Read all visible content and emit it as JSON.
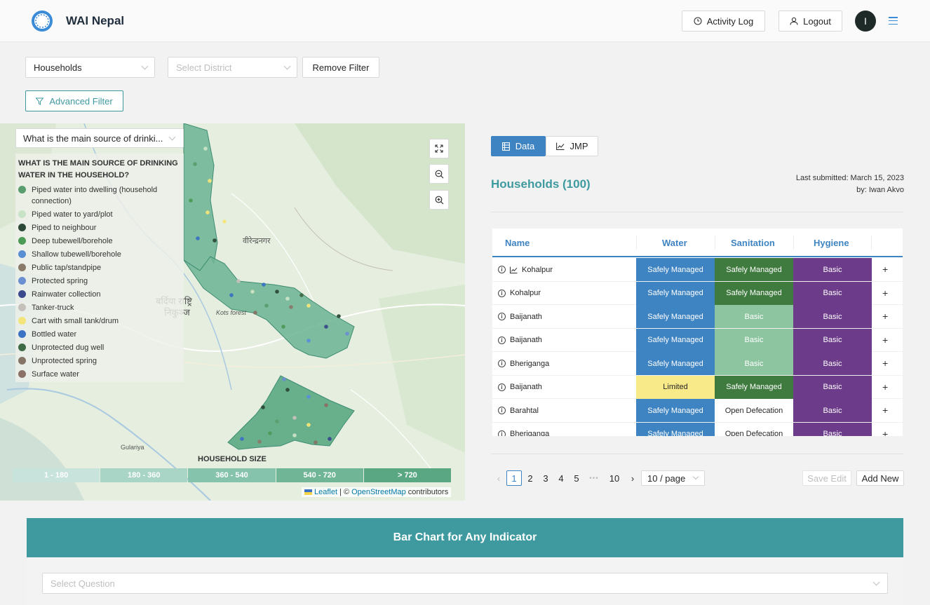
{
  "header": {
    "brand": "WAI Nepal",
    "activity_log": "Activity Log",
    "logout": "Logout",
    "avatar_initial": "I"
  },
  "filters": {
    "form_select": "Households",
    "district_placeholder": "Select District",
    "remove_filter": "Remove Filter",
    "advanced_filter": "Advanced Filter"
  },
  "map": {
    "question_select": "What is the main source of drinki...",
    "legend_title": "WHAT IS THE MAIN SOURCE OF DRINKING WATER IN THE HOUSEHOLD?",
    "legend": [
      {
        "label": "Piped water into dwelling (household connection)",
        "color": "#5a9e6f"
      },
      {
        "label": "Piped water to yard/plot",
        "color": "#c9e3c6"
      },
      {
        "label": "Piped to neighbour",
        "color": "#2d4a38"
      },
      {
        "label": "Deep tubewell/borehole",
        "color": "#4e9a57"
      },
      {
        "label": "Shallow tubewell/borehole",
        "color": "#5b8fd4"
      },
      {
        "label": "Public tap/standpipe",
        "color": "#8a7a6a"
      },
      {
        "label": "Protected spring",
        "color": "#6b8fd0"
      },
      {
        "label": "Rainwater collection",
        "color": "#3a4a8c"
      },
      {
        "label": "Tanker-truck",
        "color": "#c6c0bb"
      },
      {
        "label": "Cart with small tank/drum",
        "color": "#f3e57a"
      },
      {
        "label": "Bottled water",
        "color": "#3b72c4"
      },
      {
        "label": "Unprotected dug well",
        "color": "#3f6a46"
      },
      {
        "label": "Unprotected spring",
        "color": "#857468"
      },
      {
        "label": "Surface water",
        "color": "#8a7066"
      }
    ],
    "place_labels": {
      "birendranagar": "वीरेन्द्रनगर",
      "bardiya1": "बर्दिया राष्ट्रि",
      "bardiya2": "निकुञ्ज",
      "kots": "Kots forest",
      "gularya": "Gulariya"
    },
    "household_size_title": "HOUSEHOLD SIZE",
    "household_bins": [
      "1 - 180",
      "180 - 360",
      "360 - 540",
      "540 - 720",
      "> 720"
    ],
    "household_bin_colors": [
      "#c8e3dc",
      "#a9d5c6",
      "#86c3ad",
      "#6fb596",
      "#5aa883"
    ],
    "attribution_leaflet": "Leaflet",
    "attribution_sep": "| ©",
    "attribution_osm": "OpenStreetMap",
    "attribution_tail": "contributors"
  },
  "panel": {
    "tab_data": "Data",
    "tab_jmp": "JMP",
    "title": "Households (100)",
    "last_submitted": "Last submitted: March 15, 2023",
    "submitted_by": "by: Iwan Akvo",
    "columns": {
      "name": "Name",
      "water": "Water",
      "sanitation": "Sanitation",
      "hygiene": "Hygiene"
    },
    "rows": [
      {
        "name": "Kohalpur",
        "chart_icon": true,
        "water": "Safely Managed",
        "sanitation": "Safely Managed",
        "hygiene": "Basic"
      },
      {
        "name": "Kohalpur",
        "water": "Safely Managed",
        "sanitation": "Safely Managed",
        "hygiene": "Basic"
      },
      {
        "name": "Baijanath",
        "water": "Safely Managed",
        "sanitation": "Basic",
        "hygiene": "Basic"
      },
      {
        "name": "Baijanath",
        "water": "Safely Managed",
        "sanitation": "Basic",
        "hygiene": "Basic"
      },
      {
        "name": "Bheriganga",
        "water": "Safely Managed",
        "sanitation": "Basic",
        "hygiene": "Basic"
      },
      {
        "name": "Baijanath",
        "water": "Limited",
        "sanitation": "Safely Managed",
        "hygiene": "Basic"
      },
      {
        "name": "Barahtal",
        "water": "Safely Managed",
        "sanitation": "Open Defecation",
        "hygiene": "Basic"
      },
      {
        "name": "Bheriganga",
        "water": "Safely Managed",
        "sanitation": "Open Defecation",
        "hygiene": "Basic"
      }
    ],
    "status_colors": {
      "water_safely_managed": "#3f84c2",
      "water_limited": "#f8ea89",
      "san_safely_managed": "#3f7a3f",
      "san_basic": "#8dc5a1",
      "san_open_defecation": "#ffffff",
      "hyg_basic": "#6c3b8a"
    },
    "pagination": {
      "pages": [
        "1",
        "2",
        "3",
        "4",
        "5",
        "•••",
        "10"
      ],
      "page_size": "10 / page"
    },
    "save_edit": "Save Edit",
    "add_new": "Add New"
  },
  "bar_chart": {
    "title": "Bar Chart for Any Indicator",
    "question_placeholder": "Select Question"
  }
}
